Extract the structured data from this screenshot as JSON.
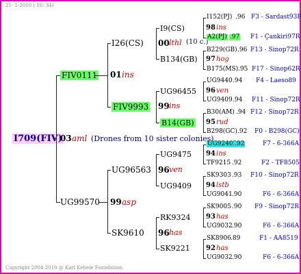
{
  "header": "21- 1-2010 ( 16: 34)",
  "footer": "Copyright 2004-2010 @ Karl Kehele Foundation.",
  "root": {
    "name": "I709(FIV)",
    "year": "03",
    "breeder": "aml",
    "note": "(Drones from 10 sister colonies)"
  },
  "gen1": [
    {
      "name": "FIV0111",
      "year": "01",
      "breeder": "ins"
    },
    {
      "name": "UG99570",
      "year": "99",
      "breeder": "asp"
    }
  ],
  "gen2": [
    {
      "name": "I26(CS)",
      "year": "00",
      "breeder": "lthl",
      "note": "(10 c.)"
    },
    {
      "name": "FIV9993",
      "year": "99",
      "breeder": "ins"
    },
    {
      "name": "UG96563",
      "year": "96",
      "breeder": "ven"
    },
    {
      "name": "SK9610",
      "year": "96",
      "breeder": "has"
    }
  ],
  "gen3": [
    {
      "name": "I9(CS)",
      "year": "98",
      "breeder": "ins"
    },
    {
      "name": "B134(GB)",
      "year": "97",
      "breeder": "hog"
    },
    {
      "name": "UG96455",
      "year": "96",
      "breeder": "ven"
    },
    {
      "name": "B14(GB)",
      "year": "95",
      "breeder": "rud"
    },
    {
      "name": "UG9475",
      "year": "94",
      "breeder": "ins"
    },
    {
      "name": "UG9409",
      "year": "94",
      "breeder": "lstb"
    },
    {
      "name": "RK9324",
      "year": "93",
      "breeder": "has"
    },
    {
      "name": "SK9221",
      "year": "92",
      "breeder": "has"
    }
  ],
  "gen4": [
    {
      "name": "I152(PJ)",
      "val": ".96",
      "ref": "F3 - Sardast93R"
    },
    {
      "name": "A2(PJ)",
      "val": ".97",
      "ref": "F1 - Çankiri97R"
    },
    {
      "name": "B229(GB)",
      "val": ".96",
      "ref": "F13 - Sinop72R"
    },
    {
      "name": "B175(MS)",
      "val": ".95",
      "ref": "F17 - Sinop62R"
    },
    {
      "name": "UG9440",
      "val": ".94",
      "ref": "F4 - Laeso89"
    },
    {
      "name": "UG9409",
      "val": ".94",
      "ref": "F11 - Sinop72R"
    },
    {
      "name": "B30(AM)",
      "val": ".94",
      "ref": "F12 - Sinop72R"
    },
    {
      "name": "B298(GC)",
      "val": ".92",
      "ref": "F0 - B298(GC)"
    },
    {
      "name": "UG92402",
      "val": ".92",
      "ref": "F7 - 6-366A"
    },
    {
      "name": "TF9215",
      "val": ".92",
      "ref": "F2 - TF8505"
    },
    {
      "name": "SK9303",
      "val": ".93",
      "ref": "F10 - Sinop72R"
    },
    {
      "name": "UG9041",
      "val": ".90",
      "ref": "F6 - 6-366A"
    },
    {
      "name": "SK9005",
      "val": ".90",
      "ref": "F9 - Sinop72R"
    },
    {
      "name": "UG9032",
      "val": ".90",
      "ref": "F6 - 6-366A"
    },
    {
      "name": "SK8906",
      "val": ".89",
      "ref": "F1 - AA8519"
    },
    {
      "name": "UG9032",
      "val": ".90",
      "ref": "F6 - 6-366A"
    }
  ]
}
